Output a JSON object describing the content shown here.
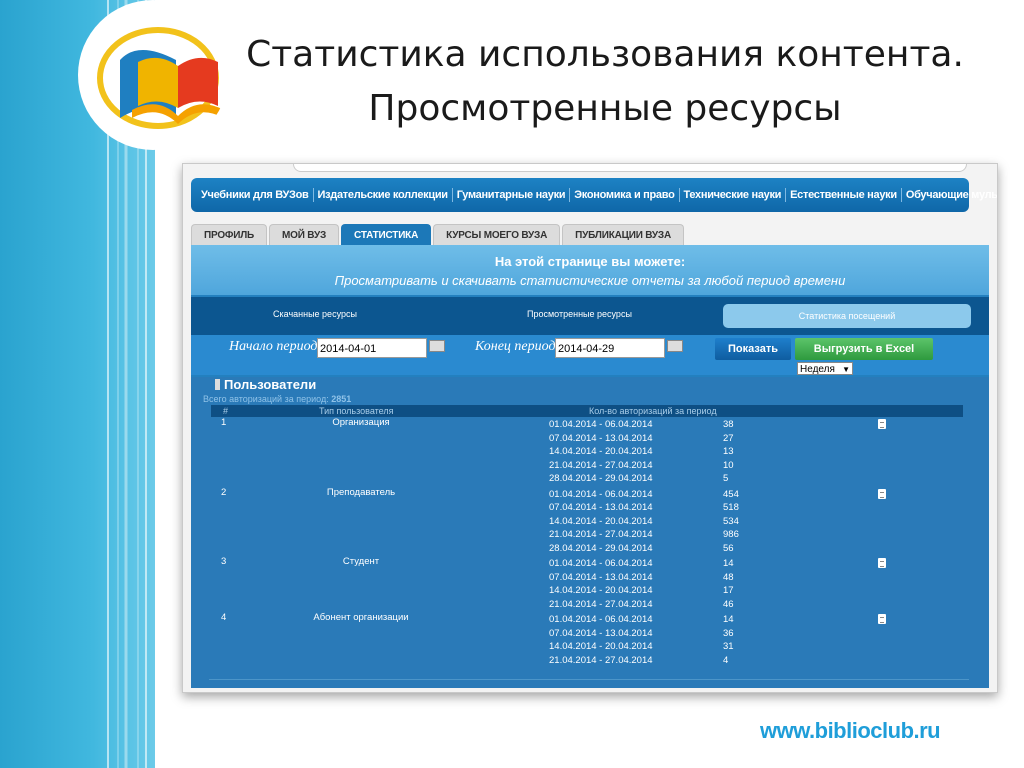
{
  "slide": {
    "title_line1": "Статистика использования контента.",
    "title_line2": "Просмотренные ресурсы",
    "website": "www.biblioclub.ru"
  },
  "top_nav": [
    "Учебники для ВУЗов",
    "Издательские коллекции",
    "Гуманитарные науки",
    "Экономика и право",
    "Технические науки",
    "Естественные науки",
    "Обучающие мультимедиа"
  ],
  "tabs": [
    {
      "label": "ПРОФИЛЬ",
      "active": false
    },
    {
      "label": "МОЙ ВУЗ",
      "active": false
    },
    {
      "label": "СТАТИСТИКА",
      "active": true
    },
    {
      "label": "КУРСЫ МОЕГО ВУЗА",
      "active": false
    },
    {
      "label": "ПУБЛИКАЦИИ ВУЗА",
      "active": false
    }
  ],
  "info": {
    "heading": "На этой странице вы можете:",
    "subtitle": "Просматривать и скачивать статистические отчеты за любой период времени"
  },
  "subnav": {
    "downloaded": "Скачанные ресурсы",
    "viewed": "Просмотренные ресурсы",
    "visits": "Статистика посещений"
  },
  "filters": {
    "start_label": "Начало периода:",
    "start_value": "2014-04-01",
    "end_label": "Конец периода:",
    "end_value": "2014-04-29",
    "show_button": "Показать",
    "excel_button": "Выгрузить в Excel",
    "period_select": "Неделя"
  },
  "users": {
    "title": "Пользователи",
    "total_label": "Всего авторизаций за период:",
    "total_value": "2851",
    "columns": [
      "#",
      "Тип пользователя",
      "Кол-во авторизаций за период"
    ],
    "groups": [
      {
        "num": "1",
        "type": "Организация",
        "rows": [
          {
            "period": "01.04.2014 - 06.04.2014",
            "count": "38"
          },
          {
            "period": "07.04.2014 - 13.04.2014",
            "count": "27"
          },
          {
            "period": "14.04.2014 - 20.04.2014",
            "count": "13"
          },
          {
            "period": "21.04.2014 - 27.04.2014",
            "count": "10"
          },
          {
            "period": "28.04.2014 - 29.04.2014",
            "count": "5"
          }
        ]
      },
      {
        "num": "2",
        "type": "Преподаватель",
        "rows": [
          {
            "period": "01.04.2014 - 06.04.2014",
            "count": "454"
          },
          {
            "period": "07.04.2014 - 13.04.2014",
            "count": "518"
          },
          {
            "period": "14.04.2014 - 20.04.2014",
            "count": "534"
          },
          {
            "period": "21.04.2014 - 27.04.2014",
            "count": "986"
          },
          {
            "period": "28.04.2014 - 29.04.2014",
            "count": "56"
          }
        ]
      },
      {
        "num": "3",
        "type": "Студент",
        "rows": [
          {
            "period": "01.04.2014 - 06.04.2014",
            "count": "14"
          },
          {
            "period": "07.04.2014 - 13.04.2014",
            "count": "48"
          },
          {
            "period": "14.04.2014 - 20.04.2014",
            "count": "17"
          },
          {
            "period": "21.04.2014 - 27.04.2014",
            "count": "46"
          }
        ]
      },
      {
        "num": "4",
        "type": "Абонент организации",
        "rows": [
          {
            "period": "01.04.2014 - 06.04.2014",
            "count": "14"
          },
          {
            "period": "07.04.2014 - 13.04.2014",
            "count": "36"
          },
          {
            "period": "14.04.2014 - 20.04.2014",
            "count": "31"
          },
          {
            "period": "21.04.2014 - 27.04.2014",
            "count": "4"
          }
        ]
      }
    ]
  }
}
